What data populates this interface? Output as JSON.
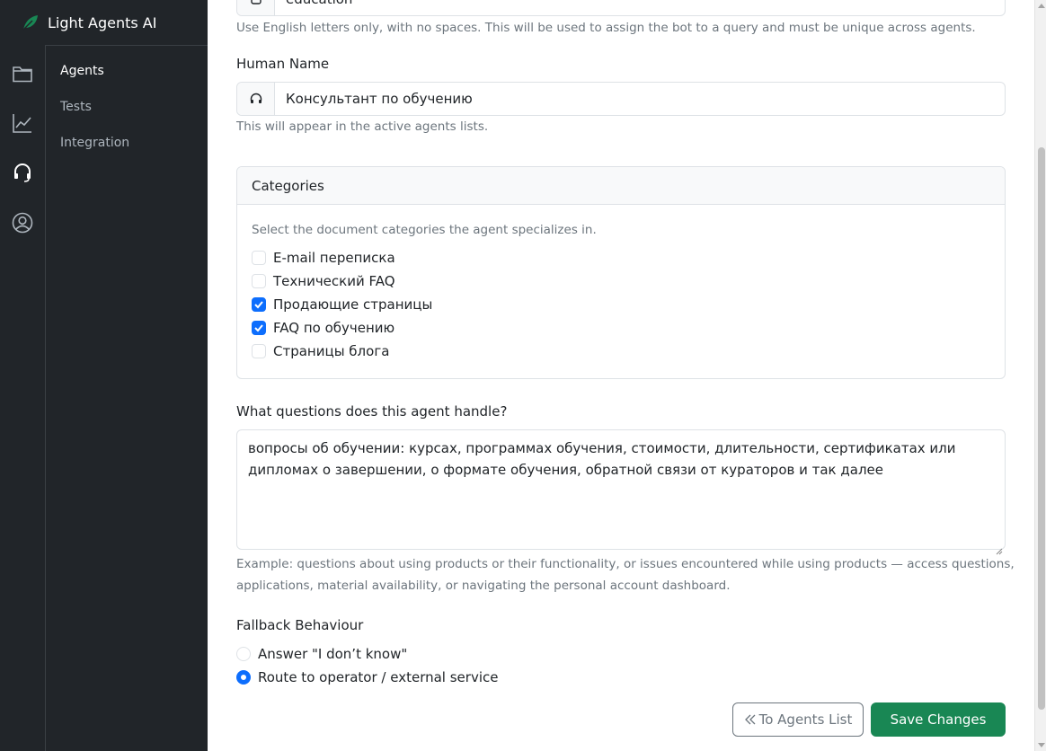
{
  "brand": {
    "name": "Light Agents AI",
    "logo_icon": "leaf-icon",
    "accent": "#198754"
  },
  "icon_nav": [
    {
      "icon": "folder-icon"
    },
    {
      "icon": "chart-line-icon"
    },
    {
      "icon": "headset-icon",
      "active": true
    },
    {
      "icon": "user-circle-icon"
    }
  ],
  "subnav": {
    "items": [
      {
        "label": "Agents",
        "active": true
      },
      {
        "label": "Tests"
      },
      {
        "label": "Integration"
      }
    ]
  },
  "form": {
    "system_name": {
      "value": "education",
      "help": "Use English letters only, with no spaces. This will be used to assign the bot to a query and must be unique across agents."
    },
    "human_name": {
      "label": "Human Name",
      "value": "Консультант по обучению",
      "help": "This will appear in the active agents lists."
    },
    "categories": {
      "title": "Categories",
      "description": "Select the document categories the agent specializes in.",
      "items": [
        {
          "label": "E-mail переписка",
          "checked": false
        },
        {
          "label": "Технический FAQ",
          "checked": false
        },
        {
          "label": "Продающие страницы",
          "checked": true
        },
        {
          "label": "FAQ по обучению",
          "checked": true
        },
        {
          "label": "Страницы блога",
          "checked": false
        }
      ]
    },
    "questions": {
      "label": "What questions does this agent handle?",
      "value_line1": "вопросы об обучении: курсах, программах обучения, стоимости, длительности, сертификатах или",
      "value_line2": "дипломах о завершении, о формате обучения, обратной связи от кураторов и так далее",
      "help_line1": "Example: questions about using products or their functionality, or issues encountered while using products — access questions,",
      "help_line2": "applications, material availability, or navigating the personal account dashboard."
    },
    "fallback": {
      "label": "Fallback Behaviour",
      "options": [
        {
          "label": "Answer \"I don’t know\"",
          "selected": false
        },
        {
          "label": "Route to operator / external service",
          "selected": true
        }
      ]
    }
  },
  "actions": {
    "back_label": "To Agents List",
    "save_label": "Save Changes"
  }
}
